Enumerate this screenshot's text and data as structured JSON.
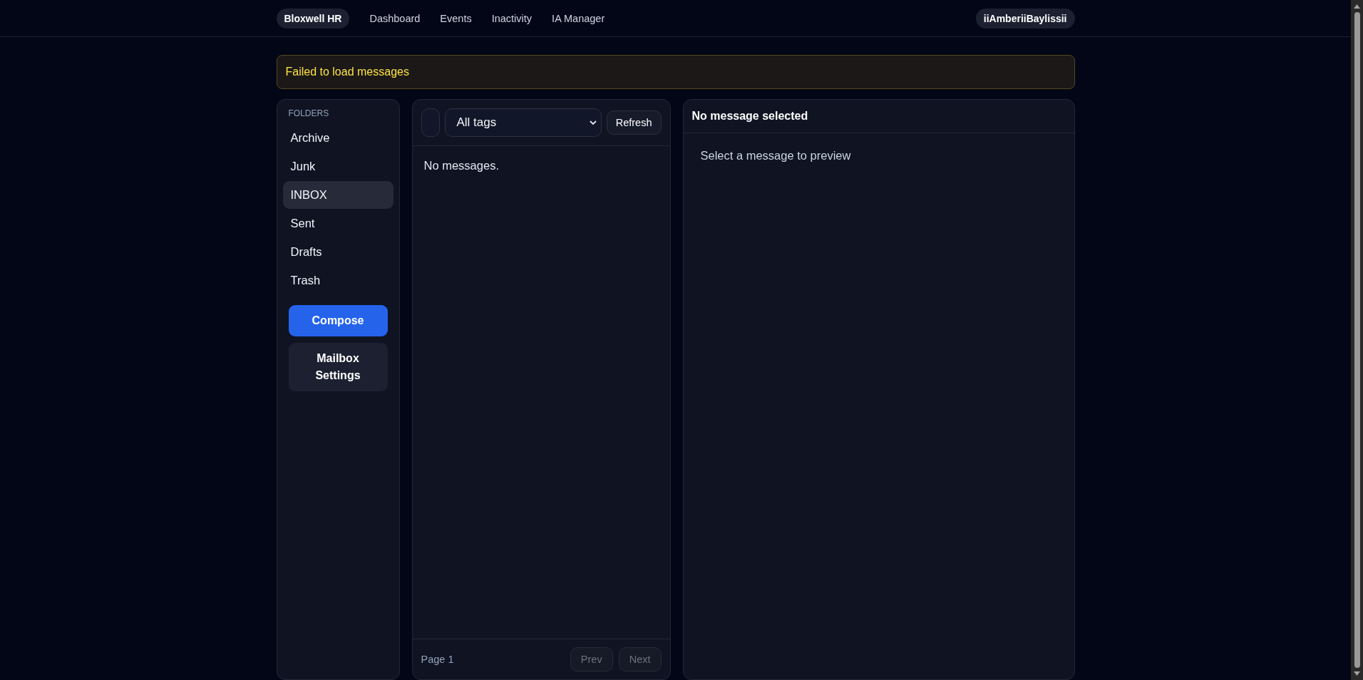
{
  "nav": {
    "brand": "Bloxwell HR",
    "links": [
      {
        "label": "Dashboard"
      },
      {
        "label": "Events"
      },
      {
        "label": "Inactivity"
      },
      {
        "label": "IA Manager"
      }
    ],
    "user": "iiAmberiiBaylissii"
  },
  "alert": {
    "message": "Failed to load messages"
  },
  "sidebar": {
    "heading": "FOLDERS",
    "items": [
      {
        "label": "Archive",
        "selected": false
      },
      {
        "label": "Junk",
        "selected": false
      },
      {
        "label": "INBOX",
        "selected": true
      },
      {
        "label": "Sent",
        "selected": false
      },
      {
        "label": "Drafts",
        "selected": false
      },
      {
        "label": "Trash",
        "selected": false
      }
    ],
    "buttons": [
      {
        "label": "Compose",
        "kind": "primary"
      },
      {
        "label": "Mailbox Settings",
        "kind": "secondary"
      }
    ]
  },
  "message_list": {
    "tag_filter": "All tags",
    "refresh": "Refresh",
    "empty": "No messages.",
    "page": "Page 1",
    "prev": {
      "label": "Prev",
      "disabled": true
    },
    "next": {
      "label": "Next",
      "disabled": true
    }
  },
  "preview": {
    "title": "No message selected",
    "hint": "Select a message to preview"
  }
}
